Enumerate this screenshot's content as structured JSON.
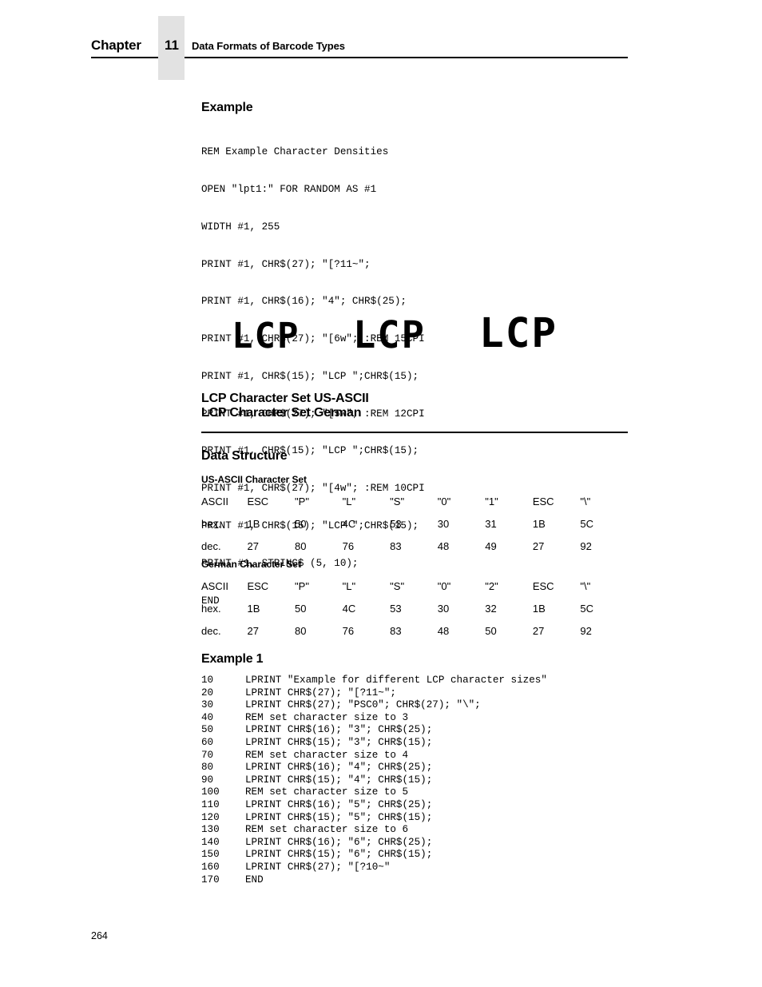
{
  "header": {
    "chapter_word": "Chapter",
    "chapter_number": "11",
    "title": "Data Formats of Barcode Types"
  },
  "example_heading": "Example",
  "example_code": [
    "REM Example Character Densities",
    "OPEN \"lpt1:\" FOR RANDOM AS #1",
    "WIDTH #1, 255",
    "PRINT #1, CHR$(27); \"[?11~\";",
    "PRINT #1, CHR$(16); \"4\"; CHR$(25);",
    "PRINT #1, CHR$(27); \"[6w\"; :REM 15CPI",
    "PRINT #1, CHR$(15); \"LCP \";CHR$(15);",
    "PRINT #1, CHR$(27); \"[5w\"; :REM 12CPI",
    "PRINT #1, CHR$(15); \"LCP \";CHR$(15);",
    "PRINT #1, CHR$(27); \"[4w\"; :REM 10CPI",
    "PRINT #1, CHR$(15); \"LCP \";CHR$(15);",
    "PRINT #1, STRING$ (5, 10);",
    "END"
  ],
  "sample": {
    "words": [
      "LCP",
      "LCP",
      "LCP"
    ]
  },
  "section_title_line1": "LCP Character Set US-ASCII",
  "section_title_line2": "LCP Character Set German",
  "data_structure_heading": "Data Structure",
  "tables": [
    {
      "caption": "US-ASCII Character Set",
      "rows": [
        {
          "label": "ASCII",
          "cells": [
            "ESC",
            "\"P\"",
            "\"L\"",
            "\"S\"",
            "\"0\"",
            "\"1\"",
            "ESC",
            "\"\\\""
          ]
        },
        {
          "label": "hex.",
          "cells": [
            "1B",
            "50",
            "4C",
            "53",
            "30",
            "31",
            "1B",
            "5C"
          ]
        },
        {
          "label": "dec.",
          "cells": [
            "27",
            "80",
            "76",
            "83",
            "48",
            "49",
            "27",
            "92"
          ]
        }
      ]
    },
    {
      "caption": "German Character Set",
      "rows": [
        {
          "label": "ASCII",
          "cells": [
            "ESC",
            "\"P\"",
            "\"L\"",
            "\"S\"",
            "\"0\"",
            "\"2\"",
            "ESC",
            "\"\\\""
          ]
        },
        {
          "label": "hex.",
          "cells": [
            "1B",
            "50",
            "4C",
            "53",
            "30",
            "32",
            "1B",
            "5C"
          ]
        },
        {
          "label": "dec.",
          "cells": [
            "27",
            "80",
            "76",
            "83",
            "48",
            "50",
            "27",
            "92"
          ]
        }
      ]
    }
  ],
  "example1_heading": "Example 1",
  "example1_listing": [
    {
      "num": "10",
      "code": "LPRINT \"Example for different LCP character sizes\""
    },
    {
      "num": "20",
      "code": "LPRINT CHR$(27); \"[?11~\";"
    },
    {
      "num": "30",
      "code": "LPRINT CHR$(27); \"PSC0\"; CHR$(27); \"\\\";"
    },
    {
      "num": "40",
      "code": "REM set character size to 3"
    },
    {
      "num": "50",
      "code": "LPRINT CHR$(16); \"3\"; CHR$(25);"
    },
    {
      "num": "60",
      "code": "LPRINT CHR$(15); \"3\"; CHR$(15);"
    },
    {
      "num": "70",
      "code": "REM set character size to 4"
    },
    {
      "num": "80",
      "code": "LPRINT CHR$(16); \"4\"; CHR$(25);"
    },
    {
      "num": "90",
      "code": "LPRINT CHR$(15); \"4\"; CHR$(15);"
    },
    {
      "num": "100",
      "code": "REM set character size to 5"
    },
    {
      "num": "110",
      "code": "LPRINT CHR$(16); \"5\"; CHR$(25);"
    },
    {
      "num": "120",
      "code": "LPRINT CHR$(15); \"5\"; CHR$(15);"
    },
    {
      "num": "130",
      "code": "REM set character size to 6"
    },
    {
      "num": "140",
      "code": "LPRINT CHR$(16); \"6\"; CHR$(25);"
    },
    {
      "num": "150",
      "code": "LPRINT CHR$(15); \"6\"; CHR$(15);"
    },
    {
      "num": "160",
      "code": "LPRINT CHR$(27); \"[?10~\""
    },
    {
      "num": "170",
      "code": "END"
    }
  ],
  "page_number": "264",
  "colors": {
    "text": "#000000",
    "chapter_box": "#e2e2e2",
    "background": "#ffffff"
  }
}
